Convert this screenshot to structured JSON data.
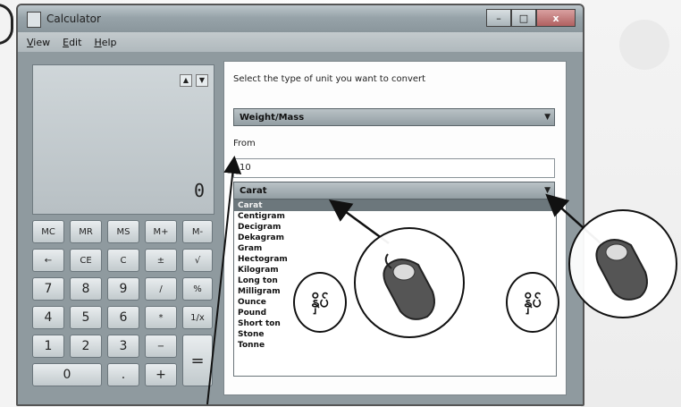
{
  "window": {
    "title": "Calculator",
    "minimize": "–",
    "maximize": "□",
    "close": "x"
  },
  "menu": [
    "View",
    "Edit",
    "Help"
  ],
  "display": {
    "value": "0",
    "history_up": "▲",
    "history_down": "▼"
  },
  "keys": {
    "row1": [
      "MC",
      "MR",
      "MS",
      "M+",
      "M-"
    ],
    "row2": [
      "←",
      "CE",
      "C",
      "±",
      "√"
    ],
    "row3": [
      "7",
      "8",
      "9",
      "/",
      "%"
    ],
    "row4": [
      "4",
      "5",
      "6",
      "*",
      "1/x"
    ],
    "row5": [
      "1",
      "2",
      "3",
      "−"
    ],
    "zero": "0",
    "dot": ".",
    "plus": "+",
    "equals": "="
  },
  "converter": {
    "instruction": "Select the type of unit you want to convert",
    "type_value": "Weight/Mass",
    "from_label": "From",
    "from_value": "10",
    "unit_value": "Carat",
    "unit_options": [
      "Carat",
      "Centigram",
      "Decigram",
      "Dekagram",
      "Gram",
      "Hectogram",
      "Kilogram",
      "Long ton",
      "Milligram",
      "Ounce",
      "Pound",
      "Short ton",
      "Stone",
      "Tonne"
    ],
    "selected_index": 0
  },
  "annotations": {
    "left_badge": "နှိပ်",
    "right_badge": "နှိပ်"
  },
  "icons": {
    "pointer": "hand-mouse-icon",
    "arrow": "pointer-arrow-icon"
  }
}
